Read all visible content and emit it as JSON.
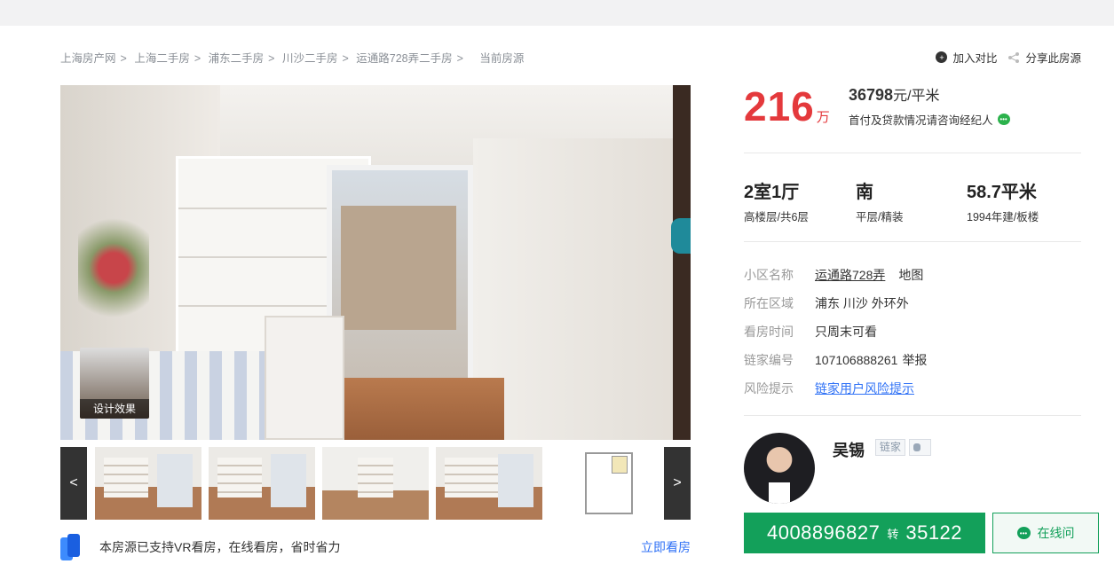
{
  "breadcrumb": {
    "items": [
      "上海房产网",
      "上海二手房",
      "浦东二手房",
      "川沙二手房",
      "运通路728弄二手房"
    ],
    "current": "当前房源"
  },
  "tools": {
    "compare": "加入对比",
    "share": "分享此房源"
  },
  "gallery": {
    "design_label": "设计效果",
    "prev": "<",
    "next": ">"
  },
  "vr": {
    "message": "本房源已支持VR看房，在线看房，省时省力",
    "action": "立即看房"
  },
  "price": {
    "total": "216",
    "total_unit": "万",
    "unit_value": "36798",
    "unit_suffix": "元/平米",
    "loan_note": "首付及贷款情况请咨询经纪人"
  },
  "specs": [
    {
      "main": "2室1厅",
      "sub": "高楼层/共6层"
    },
    {
      "main": "南",
      "sub": "平层/精装"
    },
    {
      "main": "58.7平米",
      "sub": "1994年建/板楼"
    }
  ],
  "info": {
    "community": {
      "label": "小区名称",
      "value": "运通路728弄",
      "map": "地图"
    },
    "area": {
      "label": "所在区域",
      "value": "浦东 川沙 外环外"
    },
    "viewing": {
      "label": "看房时间",
      "value": "只周末可看"
    },
    "id": {
      "label": "链家编号",
      "value": "107106888261",
      "report": "举报"
    },
    "risk": {
      "label": "风险提示",
      "value": "链家用户风险提示"
    }
  },
  "agent": {
    "name": "吴锡",
    "brand": "链家"
  },
  "contact": {
    "phone": "4008896827",
    "ext_label": "转",
    "ext": "35122",
    "online": "在线问"
  },
  "colors": {
    "price_red": "#e4393c",
    "green": "#13a05a",
    "link_blue": "#3072f6"
  }
}
